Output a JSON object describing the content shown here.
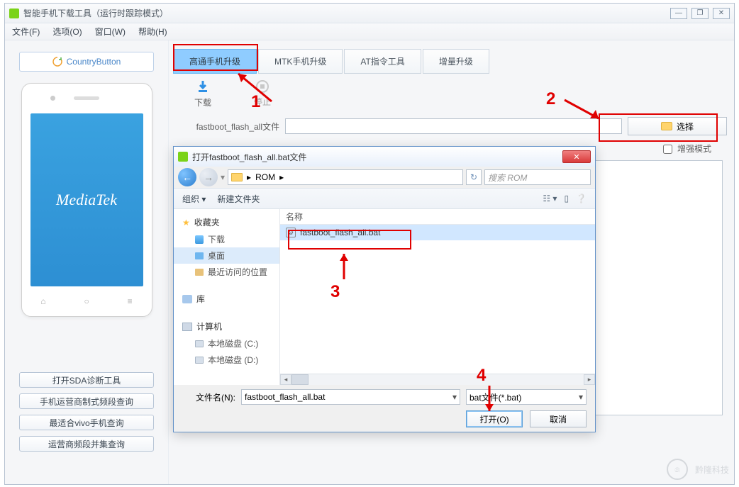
{
  "window": {
    "title": "智能手机下载工具（运行时跟踪模式）",
    "controls": {
      "min": "—",
      "max": "❐",
      "close": "✕"
    }
  },
  "menubar": {
    "file": "文件(F)",
    "options": "选项(O)",
    "window": "窗口(W)",
    "help": "帮助(H)"
  },
  "sidebar": {
    "country_btn": "CountryButton",
    "phone_brand": "MediaTek",
    "buttons": {
      "sda": "打开SDA诊断工具",
      "freq": "手机运营商制式频段查询",
      "vivo": "最适合vivo手机查询",
      "carrier": "运营商频段并集查询"
    }
  },
  "tabs": {
    "qualcomm": "高通手机升级",
    "mtk": "MTK手机升级",
    "at": "AT指令工具",
    "delta": "增量升级"
  },
  "toolbar": {
    "download": "下载",
    "stop": "停止"
  },
  "file_row": {
    "label": "fastboot_flash_all文件",
    "value": "",
    "select": "选择",
    "enhanced": "增强模式"
  },
  "annotations": {
    "n1": "1",
    "n2": "2",
    "n3": "3",
    "n4": "4"
  },
  "dialog": {
    "title": "打开fastboot_flash_all.bat文件",
    "breadcrumb_item": "ROM",
    "breadcrumb_sep": "▸",
    "search_placeholder": "搜索 ROM",
    "organize": "组织 ▾",
    "newfolder": "新建文件夹",
    "tree": {
      "fav": "收藏夹",
      "downloads": "下载",
      "desktop": "桌面",
      "recent": "最近访问的位置",
      "lib": "库",
      "computer": "计算机",
      "diskc": "本地磁盘 (C:)",
      "diskd": "本地磁盘 (D:)"
    },
    "list": {
      "header_name": "名称",
      "file1": "fastboot_flash_all.bat"
    },
    "footer": {
      "filename_label": "文件名(N):",
      "filename_value": "fastboot_flash_all.bat",
      "filter": "bat文件(*.bat)",
      "open": "打开(O)",
      "cancel": "取消"
    }
  },
  "watermark": "黔隆科技"
}
